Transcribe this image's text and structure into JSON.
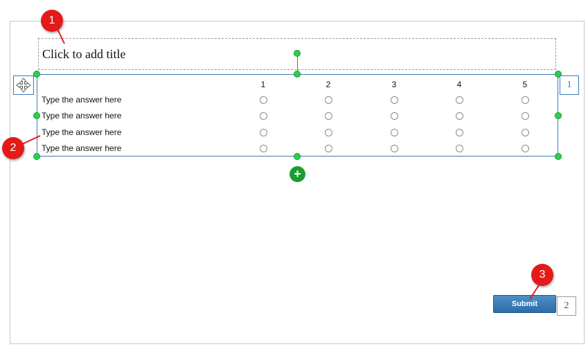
{
  "editor": {
    "title_placeholder": "Click to add title",
    "question_order": "1",
    "submit_order": "2",
    "add_symbol": "+"
  },
  "survey": {
    "columns": [
      "1",
      "2",
      "3",
      "4",
      "5"
    ],
    "rows": [
      "Type the answer here",
      "Type the answer here",
      "Type the answer here",
      "Type the answer here"
    ]
  },
  "buttons": {
    "submit_label": "Submit"
  },
  "annotations": {
    "markers": [
      "1",
      "2",
      "3"
    ]
  },
  "icons": {
    "move": "move-arrows-icon",
    "add": "plus-circle-icon"
  },
  "colors": {
    "selection_border": "#3b78b8",
    "handle": "#2bd04f",
    "add_button": "#1a9e2e",
    "submit_button": "#2e6ca6",
    "marker": "#e31a1a"
  }
}
